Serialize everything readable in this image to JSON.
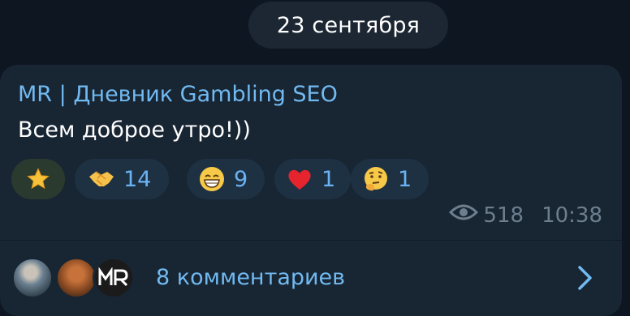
{
  "date_separator": "23 сентября",
  "message": {
    "author": "MR | Дневник Gambling SEO",
    "text": "Всем доброе утро!))",
    "views": "518",
    "time": "10:38"
  },
  "reactions": [
    {
      "icon": "star-icon",
      "count": ""
    },
    {
      "icon": "handshake-icon",
      "count": "14"
    },
    {
      "icon": "grinning-face-icon",
      "count": "9"
    },
    {
      "icon": "heart-icon",
      "count": "1"
    },
    {
      "icon": "thinking-face-icon",
      "count": "1"
    }
  ],
  "comments": {
    "label": "8 комментариев",
    "avatars": [
      "avatar-1",
      "avatar-2",
      "avatar-3"
    ]
  },
  "colors": {
    "background": "#0e1621",
    "bubble": "#182533",
    "accent": "#71baf1",
    "meta": "#6d7f8f",
    "heart": "#e5242e"
  }
}
